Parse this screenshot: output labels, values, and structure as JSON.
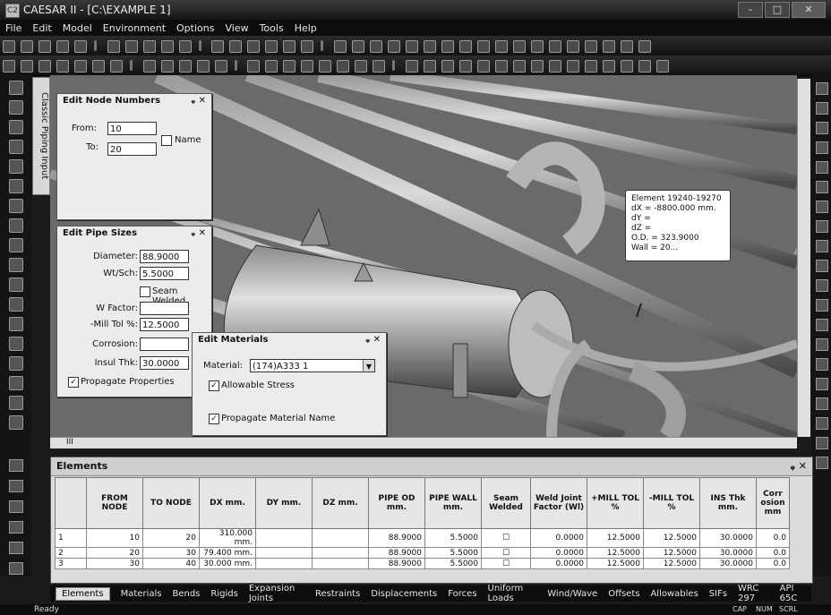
{
  "window": {
    "title": "CAESAR II - [C:\\EXAMPLE 1]",
    "icon_label": "C2"
  },
  "window_buttons": {
    "min": "–",
    "max": "□",
    "close": "✕"
  },
  "menu": [
    "File",
    "Edit",
    "Model",
    "Environment",
    "Options",
    "View",
    "Tools",
    "Help"
  ],
  "side_tab": {
    "label": "Classic Piping Input"
  },
  "edit_node_numbers": {
    "title": "Edit Node Numbers",
    "pin": "ᵩ ✕",
    "from_label": "From:",
    "from_value": "10",
    "to_label": "To:",
    "to_value": "20",
    "name_label": "Name"
  },
  "edit_pipe_sizes": {
    "title": "Edit Pipe Sizes",
    "pin": "ᵩ ✕",
    "diameter_label": "Diameter:",
    "diameter_value": "88.9000",
    "wtsch_label": "Wt/Sch:",
    "wtsch_value": "5.5000",
    "seam_label": "Seam Welded",
    "wfactor_label": "W Factor:",
    "wfactor_value": "",
    "milltol_label": "-Mill Tol %:",
    "milltol_value": "12.5000",
    "corrosion_label": "Corrosion:",
    "corrosion_value": "",
    "insul_label": "Insul Thk:",
    "insul_value": "30.0000",
    "propagate_label": "Propagate Properties"
  },
  "edit_materials": {
    "title": "Edit Materials",
    "pin": "ᵩ ✕",
    "material_label": "Material:",
    "material_value": "(174)A333 1",
    "allowable_label": "Allowable Stress",
    "propagate_label": "Propagate Material Name"
  },
  "tooltip": {
    "line1": "Element 19240-19270",
    "line2": "dX = -8800.000 mm.",
    "line3": "dY =",
    "line4": "dZ =",
    "line5": "O.D. = 323.9000",
    "line6": "Wall = 20..."
  },
  "hscroll": {
    "label": "III"
  },
  "elements": {
    "title": "Elements",
    "pin": "ᵩ ✕",
    "headers": [
      "FROM NODE",
      "TO NODE",
      "DX mm.",
      "DY mm.",
      "DZ mm.",
      "PIPE OD mm.",
      "PIPE WALL mm.",
      "Seam Welded",
      "Weld Joint Factor (Wl)",
      "+MILL TOL %",
      "-MILL TOL %",
      "INS Thk mm.",
      "Corr osion mm"
    ],
    "rows": [
      [
        "1",
        "10",
        "20",
        "310.000 mm.",
        "",
        "",
        "88.9000",
        "5.5000",
        "",
        "0.0000",
        "12.5000",
        "12.5000",
        "30.0000",
        "0.0"
      ],
      [
        "2",
        "20",
        "30",
        "79.400 mm.",
        "",
        "",
        "88.9000",
        "5.5000",
        "",
        "0.0000",
        "12.5000",
        "12.5000",
        "30.0000",
        "0.0"
      ],
      [
        "3",
        "30",
        "40",
        "30.000 mm.",
        "",
        "",
        "88.9000",
        "5.5000",
        "",
        "0.0000",
        "12.5000",
        "12.5000",
        "30.0000",
        "0.0"
      ]
    ]
  },
  "tabs": [
    "Elements",
    "Materials",
    "Bends",
    "Rigids",
    "Expansion Joints",
    "Restraints",
    "Displacements",
    "Forces",
    "Uniform Loads",
    "Wind/Wave",
    "Offsets",
    "Allowables",
    "SIFs",
    "WRC 297",
    "API 65C"
  ],
  "status": {
    "text": "Ready",
    "cap": "CAP",
    "num": "NUM",
    "scrl": "SCRL"
  }
}
